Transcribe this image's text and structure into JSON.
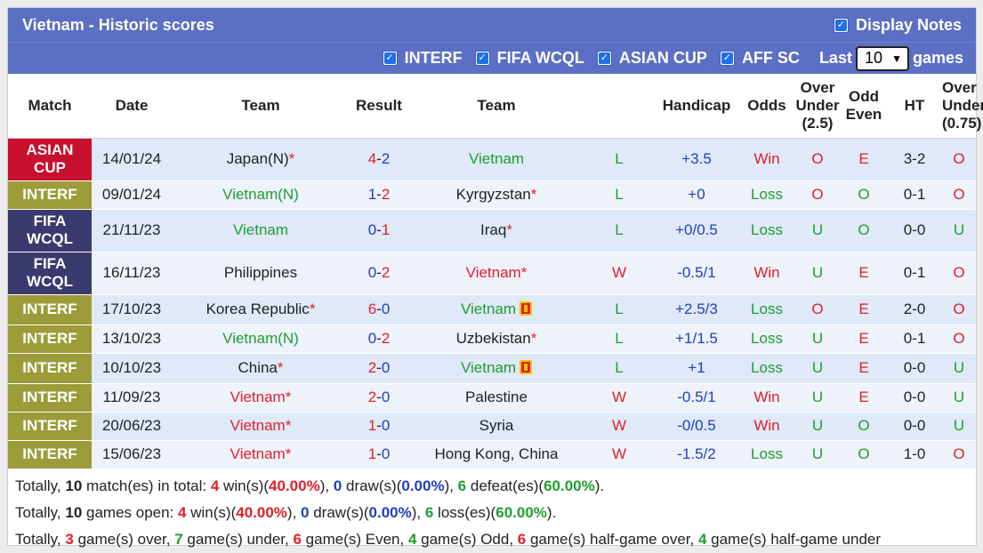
{
  "title": "Vietnam - Historic scores",
  "display_notes_label": "Display Notes",
  "filters": [
    {
      "label": "INTERF",
      "checked": true
    },
    {
      "label": "FIFA WCQL",
      "checked": true
    },
    {
      "label": "ASIAN CUP",
      "checked": true
    },
    {
      "label": "AFF SC",
      "checked": true
    }
  ],
  "last_label": "Last",
  "last_value": "10",
  "games_label": "games",
  "headers": {
    "match": "Match",
    "date": "Date",
    "team1": "Team",
    "result": "Result",
    "team2": "Team",
    "handicap": "Handicap",
    "odds": "Odds",
    "over_under_1": "Over",
    "over_under_2": "Under",
    "over_under_3": "(2.5)",
    "odd_even_1": "Odd",
    "odd_even_2": "Even",
    "ht": "HT",
    "ou2_1": "Over",
    "ou2_2": "Under",
    "ou2_3": "(0.75)"
  },
  "rows": [
    {
      "comp1": "ASIAN",
      "comp2": "CUP",
      "type": "asian",
      "date": "14/01/24",
      "team1": "Japan(N)",
      "team1_star": "*",
      "team1_color": "dark",
      "score1": "4",
      "score2": "2",
      "team2": "Vietnam",
      "team2_star": "",
      "team2_color": "green",
      "wl": "L",
      "handicap": "+3.5",
      "odds": "Win",
      "ou": "O",
      "oe": "E",
      "ht": "3-2",
      "ou2": "O"
    },
    {
      "comp1": "INTERF",
      "comp2": "",
      "type": "interf",
      "date": "09/01/24",
      "team1": "Vietnam(N)",
      "team1_star": "",
      "team1_color": "green",
      "score1": "1",
      "score2": "2",
      "team2": "Kyrgyzstan",
      "team2_star": "*",
      "team2_color": "dark",
      "wl": "L",
      "handicap": "+0",
      "odds": "Loss",
      "ou": "O",
      "oe": "O",
      "ht": "0-1",
      "ou2": "O"
    },
    {
      "comp1": "FIFA",
      "comp2": "WCQL",
      "type": "fifa",
      "date": "21/11/23",
      "team1": "Vietnam",
      "team1_star": "",
      "team1_color": "green",
      "score1": "0",
      "score2": "1",
      "team2": "Iraq",
      "team2_star": "*",
      "team2_color": "dark",
      "wl": "L",
      "handicap": "+0/0.5",
      "odds": "Loss",
      "ou": "U",
      "oe": "O",
      "ht": "0-0",
      "ou2": "U"
    },
    {
      "comp1": "FIFA",
      "comp2": "WCQL",
      "type": "fifa",
      "date": "16/11/23",
      "team1": "Philippines",
      "team1_star": "",
      "team1_color": "dark",
      "score1": "0",
      "score2": "2",
      "team2": "Vietnam",
      "team2_star": "*",
      "team2_color": "red",
      "wl": "W",
      "handicap": "-0.5/1",
      "odds": "Win",
      "ou": "U",
      "oe": "E",
      "ht": "0-1",
      "ou2": "O"
    },
    {
      "comp1": "INTERF",
      "comp2": "",
      "type": "interf",
      "date": "17/10/23",
      "team1": "Korea Republic",
      "team1_star": "*",
      "team1_color": "dark",
      "score1": "6",
      "score2": "0",
      "team2": "Vietnam",
      "team2_star": "",
      "team2_color": "green",
      "redcard": true,
      "wl": "L",
      "handicap": "+2.5/3",
      "odds": "Loss",
      "ou": "O",
      "oe": "E",
      "ht": "2-0",
      "ou2": "O"
    },
    {
      "comp1": "INTERF",
      "comp2": "",
      "type": "interf",
      "date": "13/10/23",
      "team1": "Vietnam(N)",
      "team1_star": "",
      "team1_color": "green",
      "score1": "0",
      "score2": "2",
      "team2": "Uzbekistan",
      "team2_star": "*",
      "team2_color": "dark",
      "wl": "L",
      "handicap": "+1/1.5",
      "odds": "Loss",
      "ou": "U",
      "oe": "E",
      "ht": "0-1",
      "ou2": "O"
    },
    {
      "comp1": "INTERF",
      "comp2": "",
      "type": "interf",
      "date": "10/10/23",
      "team1": "China",
      "team1_star": "*",
      "team1_color": "dark",
      "score1": "2",
      "score2": "0",
      "team2": "Vietnam",
      "team2_star": "",
      "team2_color": "green",
      "redcard": true,
      "wl": "L",
      "handicap": "+1",
      "odds": "Loss",
      "ou": "U",
      "oe": "E",
      "ht": "0-0",
      "ou2": "U"
    },
    {
      "comp1": "INTERF",
      "comp2": "",
      "type": "interf",
      "date": "11/09/23",
      "team1": "Vietnam",
      "team1_star": "*",
      "team1_color": "red",
      "score1": "2",
      "score2": "0",
      "team2": "Palestine",
      "team2_star": "",
      "team2_color": "dark",
      "wl": "W",
      "handicap": "-0.5/1",
      "odds": "Win",
      "ou": "U",
      "oe": "E",
      "ht": "0-0",
      "ou2": "U"
    },
    {
      "comp1": "INTERF",
      "comp2": "",
      "type": "interf",
      "date": "20/06/23",
      "team1": "Vietnam",
      "team1_star": "*",
      "team1_color": "red",
      "score1": "1",
      "score2": "0",
      "team2": "Syria",
      "team2_star": "",
      "team2_color": "dark",
      "wl": "W",
      "handicap": "-0/0.5",
      "odds": "Win",
      "ou": "U",
      "oe": "O",
      "ht": "0-0",
      "ou2": "U"
    },
    {
      "comp1": "INTERF",
      "comp2": "",
      "type": "interf",
      "date": "15/06/23",
      "team1": "Vietnam",
      "team1_star": "*",
      "team1_color": "red",
      "score1": "1",
      "score2": "0",
      "team2": "Hong Kong, China",
      "team2_star": "",
      "team2_color": "dark",
      "wl": "W",
      "handicap": "-1.5/2",
      "odds": "Loss",
      "ou": "U",
      "oe": "O",
      "ht": "1-0",
      "ou2": "O"
    }
  ],
  "summary": {
    "line1": {
      "a": "Totally, ",
      "n1": "10",
      "b": " match(es) in total: ",
      "n2": "4",
      "c": " win(s)(",
      "p2": "40.00%",
      "d": "), ",
      "n3": "0",
      "e": " draw(s)(",
      "p3": "0.00%",
      "f": "), ",
      "n4": "6",
      "g": " defeat(es)(",
      "p4": "60.00%",
      "h": ")."
    },
    "line2": {
      "a": "Totally, ",
      "n1": "10",
      "b": " games open: ",
      "n2": "4",
      "c": " win(s)(",
      "p2": "40.00%",
      "d": "), ",
      "n3": "0",
      "e": " draw(s)(",
      "p3": "0.00%",
      "f": "), ",
      "n4": "6",
      "g": " loss(es)(",
      "p4": "60.00%",
      "h": ")."
    },
    "line3": {
      "a": "Totally, ",
      "n1": "3",
      "b": " game(s) over, ",
      "n2": "7",
      "c": " game(s) under, ",
      "n3": "6",
      "d": " game(s) Even, ",
      "n4": "4",
      "e": " game(s) Odd, ",
      "n5": "6",
      "f": " game(s) half-game over, ",
      "n6": "4",
      "g": " game(s) half-game under"
    }
  },
  "colors": {
    "header_bg": "#5b6fc4",
    "asian_cup": "#c8102e",
    "interf": "#9c9c3a",
    "fifa": "#3a3a6e",
    "win": "#e0202a",
    "loss": "#1e9e2e",
    "draw": "#1f3fbf"
  }
}
